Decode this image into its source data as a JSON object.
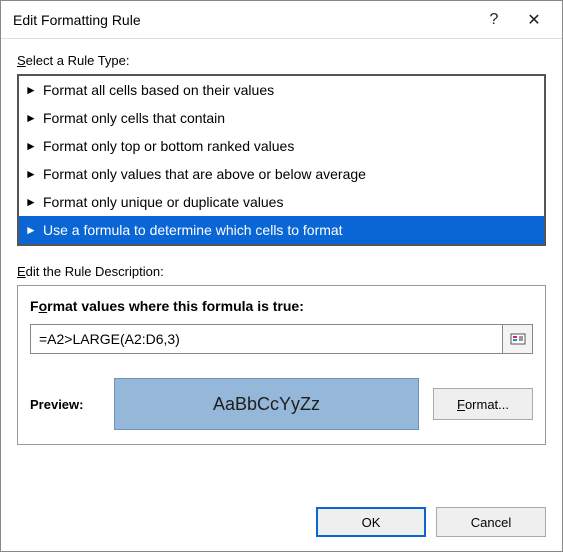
{
  "title": "Edit Formatting Rule",
  "titlebar": {
    "help_glyph": "?",
    "close_glyph": "✕"
  },
  "select_label_pre": "S",
  "select_label_rest": "elect a Rule Type:",
  "rule_types": {
    "marker": "►",
    "items": [
      {
        "text": "Format all cells based on their values",
        "selected": false
      },
      {
        "text": "Format only cells that contain",
        "selected": false
      },
      {
        "text": "Format only top or bottom ranked values",
        "selected": false
      },
      {
        "text": "Format only values that are above or below average",
        "selected": false
      },
      {
        "text": "Format only unique or duplicate values",
        "selected": false
      },
      {
        "text": "Use a formula to determine which cells to format",
        "selected": true
      }
    ]
  },
  "edit_label_pre": "E",
  "edit_label_rest": "dit the Rule Description:",
  "desc": {
    "title_pre": "F",
    "title_under": "o",
    "title_rest": "rmat values where this formula is true:",
    "formula": "=A2>LARGE(A2:D6,3)"
  },
  "preview": {
    "label": "Preview:",
    "sample": "AaBbCcYyZz",
    "bg": "#95b7d9",
    "border": "#6f92b5",
    "text_color": "#1e1e1e"
  },
  "buttons": {
    "format_pre": "F",
    "format_rest": "ormat...",
    "ok": "OK",
    "cancel": "Cancel"
  }
}
